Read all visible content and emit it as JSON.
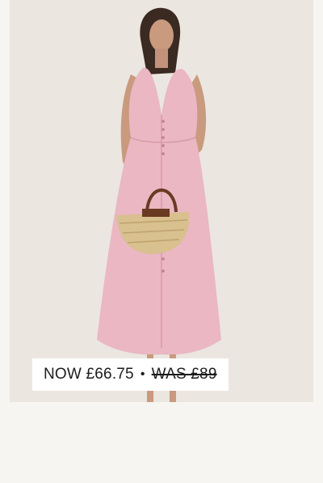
{
  "product": {
    "image_alt": "Model wearing a pink sleeveless midi dress holding a straw basket bag",
    "price": {
      "now_label": "NOW £66.75",
      "separator": "•",
      "was_label": "WAS £89"
    }
  },
  "colors": {
    "background": "#f7f5f1",
    "card": "#ebe6e0",
    "dress": "#eab7c3",
    "text": "#1c1c1c"
  }
}
